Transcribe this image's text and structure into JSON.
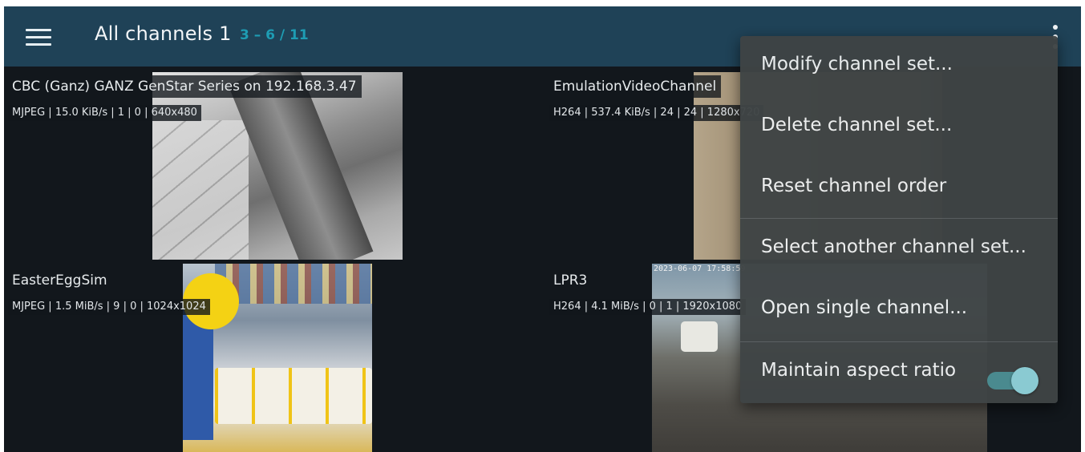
{
  "toolbar": {
    "title": "All channels 1",
    "range": "3 – 6 / 11",
    "menu_icon": "hamburger-menu-icon",
    "overflow_icon": "vertical-dots-icon"
  },
  "channels": [
    {
      "name": "CBC (Ganz) GANZ GenStar Series on 192.168.3.47",
      "info": "MJPEG | 15.0 KiB/s | 1 | 0 | 640x480"
    },
    {
      "name": "EmulationVideoChannel",
      "info": "H264 | 537.4 KiB/s | 24 | 24 | 1280x720"
    },
    {
      "name": "EasterEggSim",
      "info": "MJPEG | 1.5 MiB/s | 9 | 0 | 1024x1024"
    },
    {
      "name": "LPR3",
      "info": "H264 | 4.1 MiB/s | 0 | 1 | 1920x1080",
      "timestamp": "2023-06-07 17:58:59"
    }
  ],
  "menu": {
    "items": [
      {
        "label": "Modify channel set..."
      },
      {
        "label": "Delete channel set..."
      },
      {
        "label": "Reset channel order"
      },
      {
        "label": "Select another channel set..."
      },
      {
        "label": "Open single channel..."
      },
      {
        "label": "Maintain aspect ratio",
        "toggle_on": true
      }
    ]
  },
  "colors": {
    "toolbar_bg": "#1f4257",
    "accent": "#1e9cb3",
    "background": "#12171c",
    "menu_bg": "#3f4445",
    "toggle_track": "#4d8f94",
    "toggle_thumb": "#8fd2da"
  }
}
